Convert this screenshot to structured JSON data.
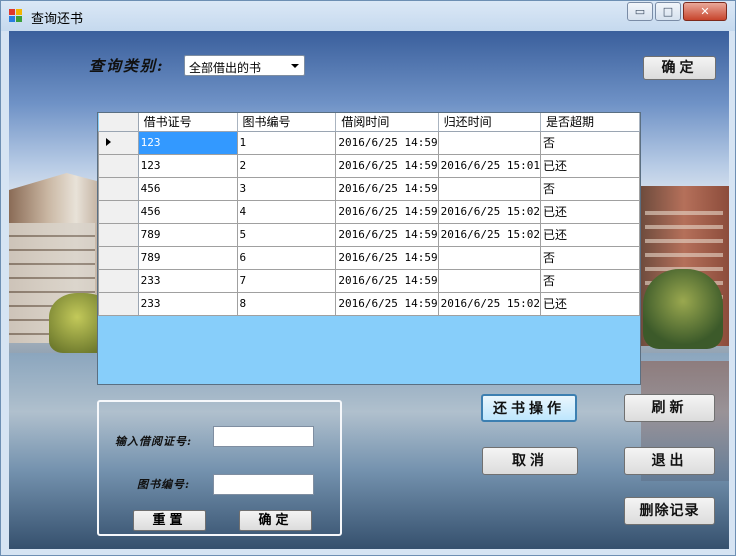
{
  "window": {
    "title": "查询还书",
    "buttons": {
      "minimize": "▭",
      "maximize": "□",
      "close": "✕"
    },
    "icon_colors": [
      "#e0372c",
      "#f4b400",
      "#2a7de1",
      "#3aa03a"
    ]
  },
  "filter": {
    "label": "查询类别:",
    "selected": "全部借出的书",
    "confirm_label": "确定"
  },
  "grid": {
    "columns": [
      "借书证号",
      "图书编号",
      "借阅时间",
      "归还时间",
      "是否超期"
    ],
    "rows": [
      [
        "123",
        "1",
        "2016/6/25 14:59",
        "",
        "否"
      ],
      [
        "123",
        "2",
        "2016/6/25 14:59",
        "2016/6/25 15:01",
        "已还"
      ],
      [
        "456",
        "3",
        "2016/6/25 14:59",
        "",
        "否"
      ],
      [
        "456",
        "4",
        "2016/6/25 14:59",
        "2016/6/25 15:02",
        "已还"
      ],
      [
        "789",
        "5",
        "2016/6/25 14:59",
        "2016/6/25 15:02",
        "已还"
      ],
      [
        "789",
        "6",
        "2016/6/25 14:59",
        "",
        "否"
      ],
      [
        "233",
        "7",
        "2016/6/25 14:59",
        "",
        "否"
      ],
      [
        "233",
        "8",
        "2016/6/25 14:59",
        "2016/6/25 15:02",
        "已还"
      ]
    ],
    "selection_color": "#3399ff",
    "background_color": "#87cefa"
  },
  "return_panel": {
    "card_label": "输入借阅证号:",
    "book_label": "图书编号:",
    "card_value": "",
    "book_value": "",
    "reset_label": "重置",
    "confirm_label": "确定"
  },
  "actions": {
    "return_label": "还书操作",
    "refresh_label": "刷新",
    "cancel_label": "取消",
    "exit_label": "退出",
    "delete_label": "删除记录"
  }
}
